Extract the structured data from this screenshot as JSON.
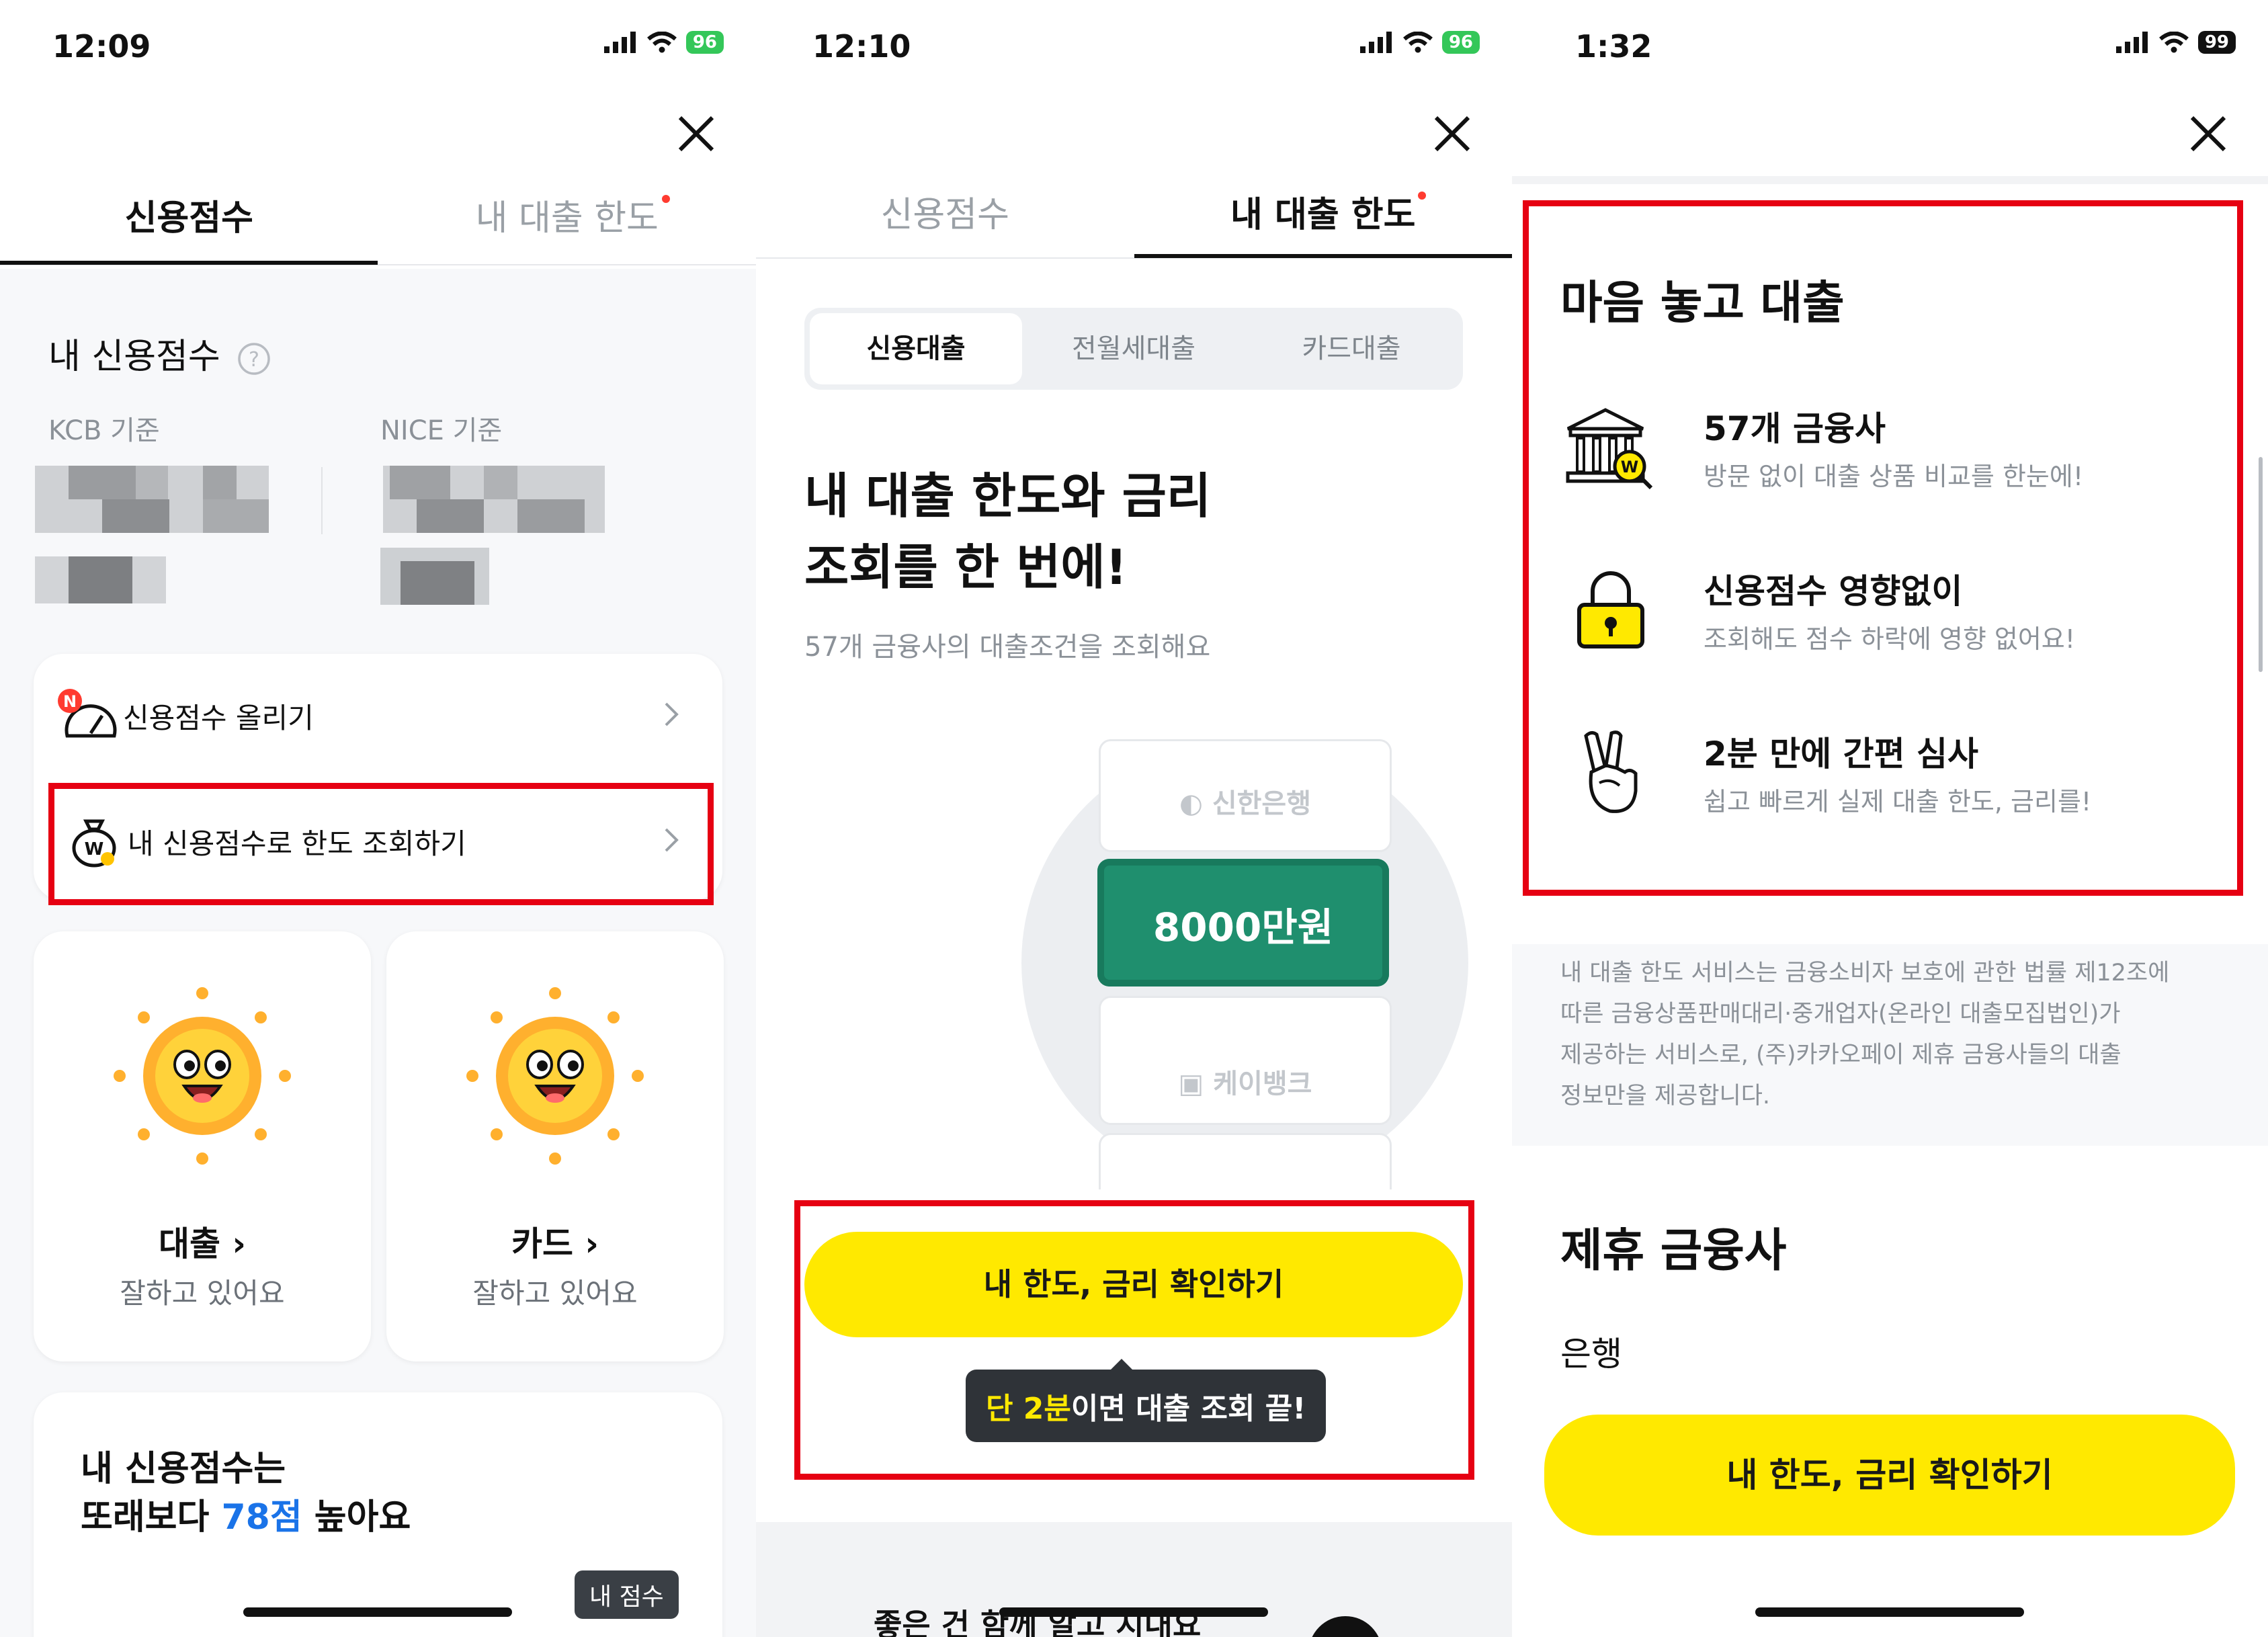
{
  "panel1": {
    "status": {
      "time": "12:09",
      "battery": "96"
    },
    "tabs": [
      {
        "label": "신용점수"
      },
      {
        "label": "내 대출 한도"
      }
    ],
    "section_title": "내 신용점수",
    "kcb_label": "KCB 기준",
    "nice_label": "NICE 기준",
    "menu": [
      {
        "label": "신용점수 올리기",
        "badge": "N"
      },
      {
        "label": "내 신용점수로 한도 조회하기"
      }
    ],
    "cards": [
      {
        "title": "대출",
        "subtitle": "잘하고 있어요"
      },
      {
        "title": "카드",
        "subtitle": "잘하고 있어요"
      }
    ],
    "compare": {
      "line1": "내 신용점수는",
      "line2_prefix": "또래보다 ",
      "highlight": "78점",
      "line2_suffix": " 높아요",
      "tooltip": "내 점수"
    }
  },
  "panel2": {
    "status": {
      "time": "12:10",
      "battery": "96"
    },
    "tabs": [
      {
        "label": "신용점수"
      },
      {
        "label": "내 대출 한도"
      }
    ],
    "segments": [
      {
        "label": "신용대출"
      },
      {
        "label": "전월세대출"
      },
      {
        "label": "카드대출"
      }
    ],
    "headline_line1": "내 대출 한도와 금리",
    "headline_line2": "조회를 한 번에!",
    "subtext": "57개 금융사의 대출조건을 조회해요",
    "illustration": {
      "top_bank": "신한은행",
      "amount": "8000만원",
      "bottom_bank": "케이뱅크"
    },
    "cta": "내 한도, 금리 확인하기",
    "tooltip": {
      "highlight": "단 2분",
      "rest": "이면 대출 조회 끝!"
    },
    "bottom_peek": "좋은 건 함께 알고 지내요"
  },
  "panel3": {
    "status": {
      "time": "1:32",
      "battery": "99"
    },
    "title": "마음 놓고 대출",
    "features": [
      {
        "icon": "bank-icon",
        "title": "57개 금융사",
        "desc": "방문 없이 대출 상품 비교를 한눈에!"
      },
      {
        "icon": "lock-icon",
        "title": "신용점수 영향없이",
        "desc": "조회해도 점수 하락에 영향 없어요!"
      },
      {
        "icon": "peace-hand-icon",
        "title": "2분 만에 간편 심사",
        "desc": "쉽고 빠르게 실제 대출 한도, 금리를!"
      }
    ],
    "disclaimer_lines": [
      "내 대출 한도 서비스는 금융소비자 보호에 관한 법률 제12조에",
      "따른 금융상품판매대리·중개업자(온라인 대출모집법인)가",
      "제공하는 서비스로, (주)카카오페이 제휴 금융사들의 대출",
      "정보만을 제공합니다."
    ],
    "partners_title": "제휴 금융사",
    "partners_sub": "은행",
    "cta": "내 한도, 금리 확인하기"
  },
  "colors": {
    "accent_yellow": "#ffe900",
    "highlight_red": "#e60012",
    "money_green": "#1f8f6e",
    "score_blue": "#1a73e8"
  }
}
